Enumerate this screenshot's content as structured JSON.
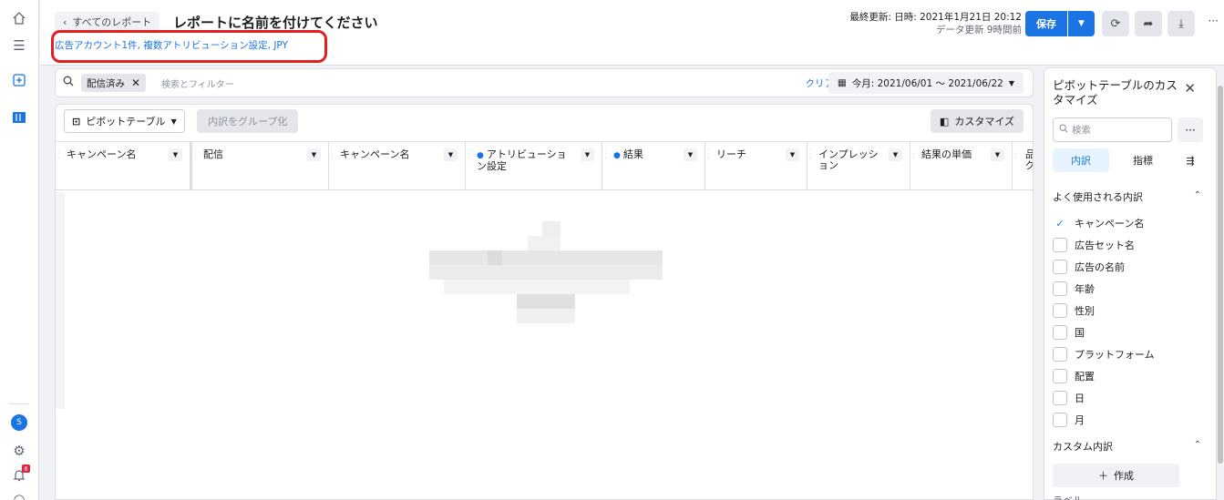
{
  "header": {
    "back_label": "すべてのレポート",
    "title": "レポートに名前を付けてください",
    "subtitle": "広告アカウント1件, 複数アトリビューション設定, JPY",
    "last_updated": "最終更新: 日時: 2021年1月21日 20:12",
    "data_updated": "データ更新 9時間前",
    "save_label": "保存"
  },
  "filter": {
    "chip_label": "配信済み",
    "placeholder": "検索とフィルター",
    "clear_label": "クリア",
    "date_range": "今月: 2021/06/01 ～ 2021/06/22"
  },
  "toolbar": {
    "pivot_label": "ピボットテーブル",
    "group_label": "内訳をグループ化",
    "customize_label": "カスタマイズ"
  },
  "table": {
    "columns": [
      {
        "label": "キャンペーン名",
        "info": false
      },
      {
        "label": "配信",
        "info": false
      },
      {
        "label": "キャンペーン名",
        "info": false
      },
      {
        "label": "アトリビューション設定",
        "info": true
      },
      {
        "label": "結果",
        "info": true
      },
      {
        "label": "リーチ",
        "info": false
      },
      {
        "label": "インプレッション",
        "info": false
      },
      {
        "label": "結果の単価",
        "info": false
      },
      {
        "label": "品グ",
        "info": false
      }
    ]
  },
  "sidebar": {
    "title": "ピボットテーブルのカスタマイズ",
    "search_placeholder": "検索",
    "tabs": [
      "内訳",
      "指標"
    ],
    "section_common": "よく使用される内訳",
    "items": [
      {
        "label": "キャンペーン名",
        "checked": true
      },
      {
        "label": "広告セット名",
        "checked": false
      },
      {
        "label": "広告の名前",
        "checked": false
      },
      {
        "label": "年齢",
        "checked": false
      },
      {
        "label": "性別",
        "checked": false
      },
      {
        "label": "国",
        "checked": false
      },
      {
        "label": "プラットフォーム",
        "checked": false
      },
      {
        "label": "配置",
        "checked": false
      },
      {
        "label": "日",
        "checked": false
      },
      {
        "label": "月",
        "checked": false
      }
    ],
    "section_custom": "カスタム内訳",
    "create_label": "作成",
    "section_label": "ラベル"
  },
  "colors": {
    "accent": "#1b74e4",
    "highlight": "#e41e1e",
    "notification": "#e41e3f"
  },
  "rail": {
    "notification_count": "8",
    "avatar_letter": "S"
  }
}
